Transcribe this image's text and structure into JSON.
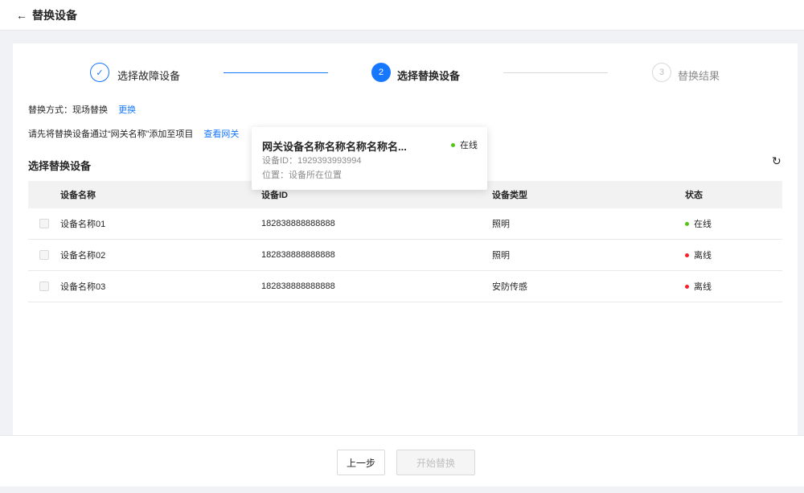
{
  "header": {
    "back_icon": "←",
    "title": "替换设备"
  },
  "steps": [
    {
      "label": "选择故障设备",
      "state": "done",
      "icon": "✓"
    },
    {
      "label": "选择替换设备",
      "state": "active",
      "number": "2"
    },
    {
      "label": "替换结果",
      "state": "wait",
      "number": "3"
    }
  ],
  "replace_mode": {
    "text": "替换方式：现场替换",
    "link": "更换"
  },
  "instruction": {
    "text": "请先将替换设备通过“网关名称”添加至项目",
    "link": "查看网关"
  },
  "section": {
    "title": "选择替换设备",
    "refresh_icon": "↻"
  },
  "table": {
    "headers": [
      "设备名称",
      "设备ID",
      "设备类型",
      "状态"
    ],
    "rows": [
      {
        "name": "设备名称01",
        "id": "182838888888888",
        "type": "照明",
        "status": "在线",
        "status_color": "#52c41a"
      },
      {
        "name": "设备名称02",
        "id": "182838888888888",
        "type": "照明",
        "status": "离线",
        "status_color": "#f5222d"
      },
      {
        "name": "设备名称03",
        "id": "182838888888888",
        "type": "安防传感",
        "status": "离线",
        "status_color": "#f5222d"
      }
    ]
  },
  "popover": {
    "title": "网关设备名称名称名称名称名...",
    "status": "在线",
    "status_color": "#52c41a",
    "device_id": "设备ID：1929393993994",
    "location": "位置：设备所在位置"
  },
  "footer": {
    "prev": "上一步",
    "start": "开始替换"
  },
  "colors": {
    "primary": "#1677ff",
    "online": "#52c41a",
    "offline": "#f5222d"
  }
}
